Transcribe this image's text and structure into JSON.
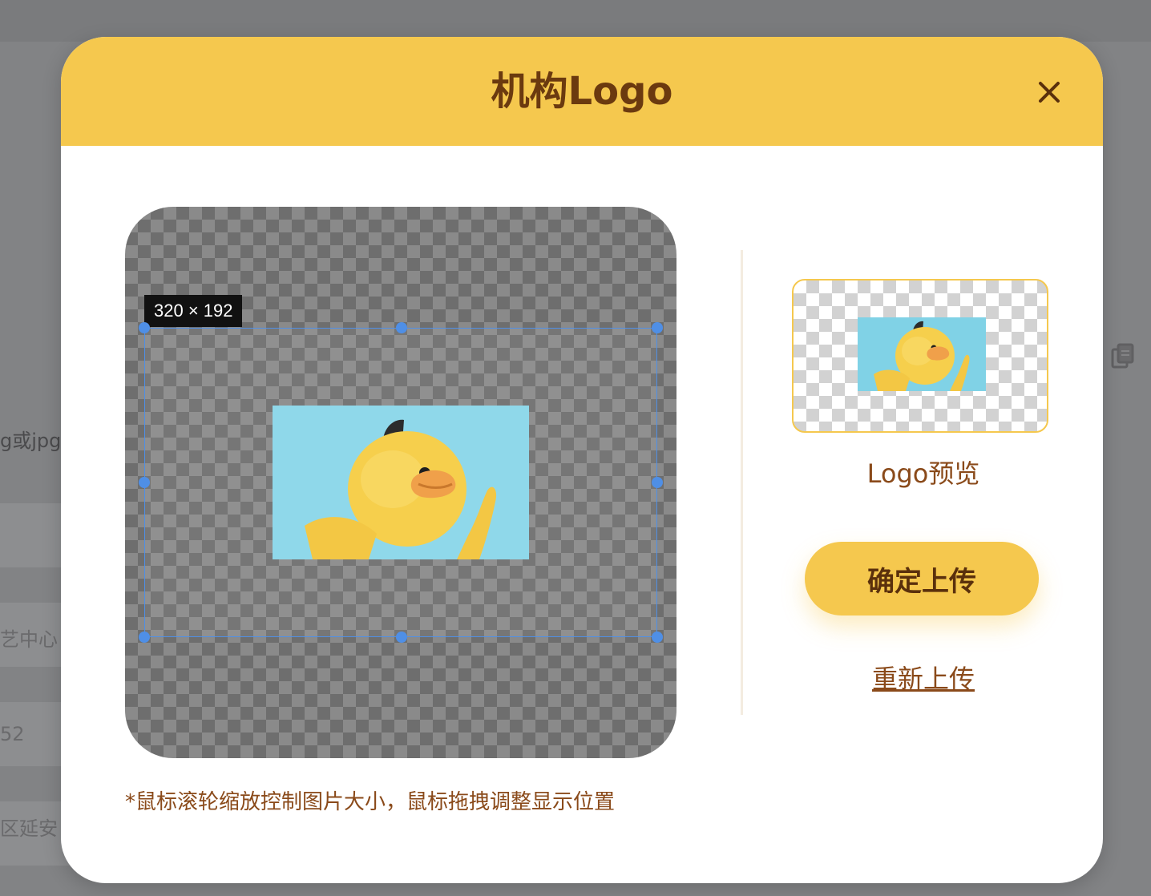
{
  "background": {
    "partial_texts": [
      "g或jpg",
      "艺中心",
      "52",
      "区延安"
    ],
    "icon": "copy-icon"
  },
  "modal": {
    "title": "机构Logo",
    "close_icon": "close-icon"
  },
  "cropper": {
    "size_label": "320 × 192",
    "hint": "*鼠标滚轮缩放控制图片大小，鼠标拖拽调整显示位置"
  },
  "preview": {
    "label": "Logo预览"
  },
  "actions": {
    "confirm_label": "确定上传",
    "reupload_label": "重新上传"
  },
  "colors": {
    "header": "#f5c84e",
    "title_text": "#6b3a0f",
    "accent_text": "#8a4a1a",
    "crop_border": "#4f8fe6",
    "image_bg": "#8fd8ea",
    "duck": "#f6cf4c",
    "beak": "#f0a04a"
  }
}
